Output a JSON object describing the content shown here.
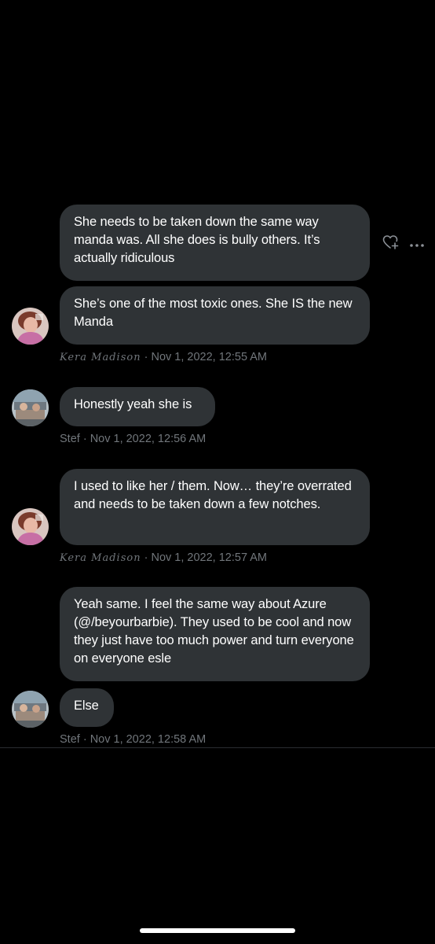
{
  "messages": [
    {
      "text": "She needs to be taken down the same way manda was. All she does is bully others. It’s actually ridiculous"
    },
    {
      "text": "She’s one of the most toxic ones. She IS the new Manda"
    },
    {
      "text": "Honestly yeah she is"
    },
    {
      "text": "I used to like her / them. Now… they’re overrated and needs to be taken down a few notches."
    },
    {
      "text": "Yeah same. I feel the same way about Azure (@/beyourbarbie). They used to be cool and now they just have too much power and turn everyone on everyone esle"
    },
    {
      "text": "Else"
    }
  ],
  "meta": [
    {
      "name": "Kera Madison",
      "separator": " · ",
      "timestamp": "Nov 1, 2022, 12:55 AM"
    },
    {
      "name": "Stef",
      "separator": " · ",
      "timestamp": "Nov 1, 2022, 12:56 AM"
    },
    {
      "name": "Kera Madison",
      "separator": " · ",
      "timestamp": "Nov 1, 2022, 12:57 AM"
    },
    {
      "name": "Stef",
      "separator": " · ",
      "timestamp": "Nov 1, 2022, 12:58 AM"
    }
  ],
  "icons": {
    "react": "heart-plus-icon",
    "more": "more-options-icon"
  },
  "colors": {
    "background": "#000000",
    "bubble": "#2f3336",
    "meta_text": "#71767b"
  }
}
